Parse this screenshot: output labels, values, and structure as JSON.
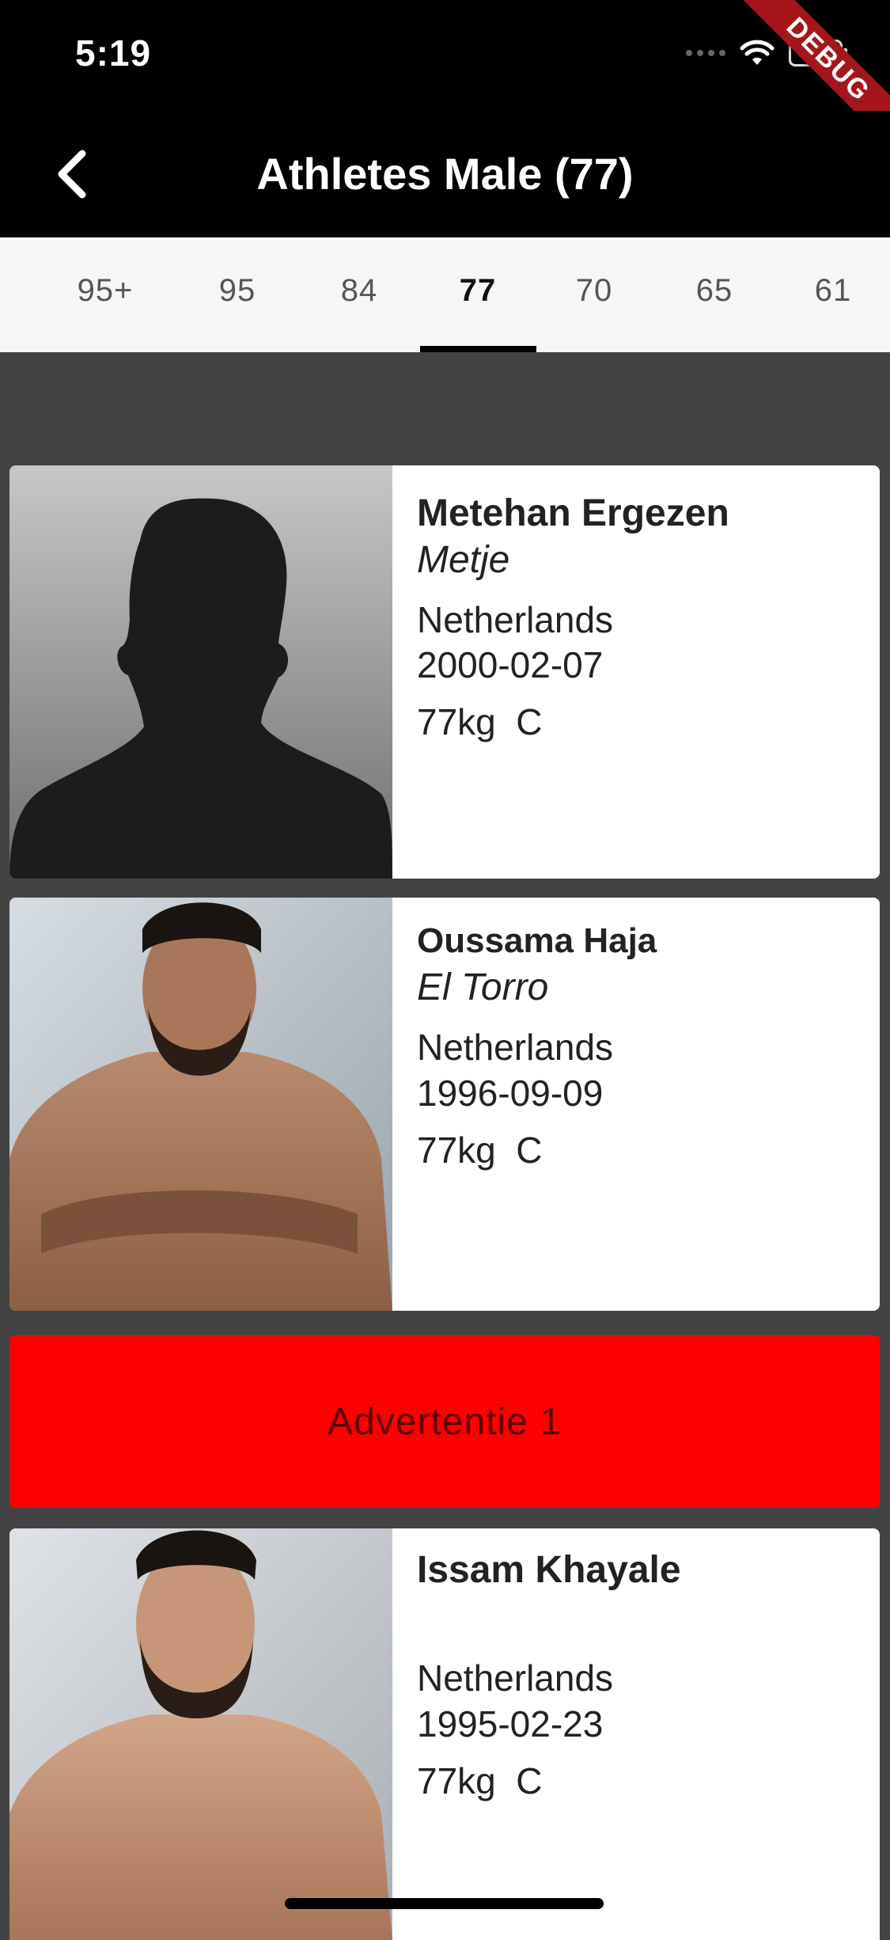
{
  "status": {
    "time": "5:19"
  },
  "debug_label": "DEBUG",
  "appbar": {
    "title": "Athletes Male (77)"
  },
  "tabs": [
    {
      "label": "95+",
      "active": false
    },
    {
      "label": "95",
      "active": false
    },
    {
      "label": "84",
      "active": false
    },
    {
      "label": "77",
      "active": true
    },
    {
      "label": "70",
      "active": false
    },
    {
      "label": "65",
      "active": false
    },
    {
      "label": "61",
      "active": false
    }
  ],
  "athletes": [
    {
      "name": "Metehan Ergezen",
      "nickname": "Metje",
      "country": "Netherlands",
      "dob": "2000-02-07",
      "weight_class": "77kg  C",
      "photo": "silhouette-placeholder"
    },
    {
      "name": "Oussama Haja",
      "nickname": "El Torro",
      "country": "Netherlands",
      "dob": "1996-09-09",
      "weight_class": "77kg  C",
      "photo": "athlete-photo"
    },
    {
      "name": "Issam Khayale",
      "nickname": "",
      "country": "Netherlands",
      "dob": "1995-02-23",
      "weight_class": "77kg  C",
      "photo": "athlete-photo"
    }
  ],
  "advert": {
    "label": "Advertentie 1",
    "color": "#ff0000"
  },
  "colors": {
    "appbar": "#000000",
    "background": "#434343",
    "tabs_bg": "#f6f6f6",
    "debug": "#a4161a"
  }
}
